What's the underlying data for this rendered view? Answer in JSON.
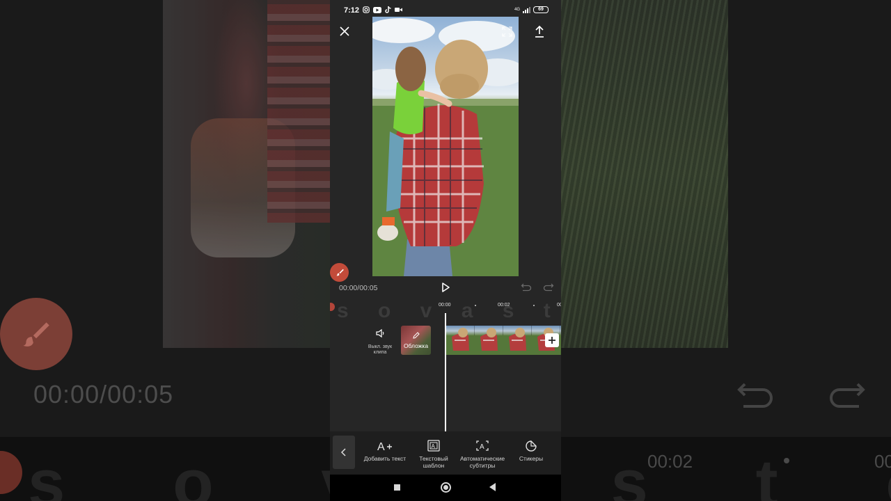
{
  "status_bar": {
    "time": "7:12",
    "network_label": "4G",
    "battery_level": "69",
    "icons": [
      "instagram-icon",
      "youtube-icon",
      "tiktok-icon",
      "video-camera-icon"
    ]
  },
  "preview": {
    "time_display": "00:00/00:05"
  },
  "timeline": {
    "watermark": "s o v a s t o r y s",
    "ticks": [
      "00:00",
      "00:02",
      "00"
    ],
    "mute_label": "Выкл. звук клипа",
    "cover_label": "Обложка"
  },
  "toolbar": {
    "items": [
      {
        "label": "Добавить текст",
        "icon": "text-add-icon"
      },
      {
        "label": "Текстовый шаблон",
        "icon": "text-template-icon"
      },
      {
        "label": "Автоматические субтитры",
        "icon": "auto-captions-icon"
      },
      {
        "label": "Стикеры",
        "icon": "sticker-icon"
      }
    ]
  },
  "background": {
    "time_display": "00:00/00:05",
    "ruler_time": "00:02",
    "ruler_time2": "00",
    "ruler_letters": "s o v a s t o r y s"
  },
  "colors": {
    "accent_red": "#c24b3a",
    "panel": "#262626",
    "toolbar": "#1e1e1e"
  }
}
